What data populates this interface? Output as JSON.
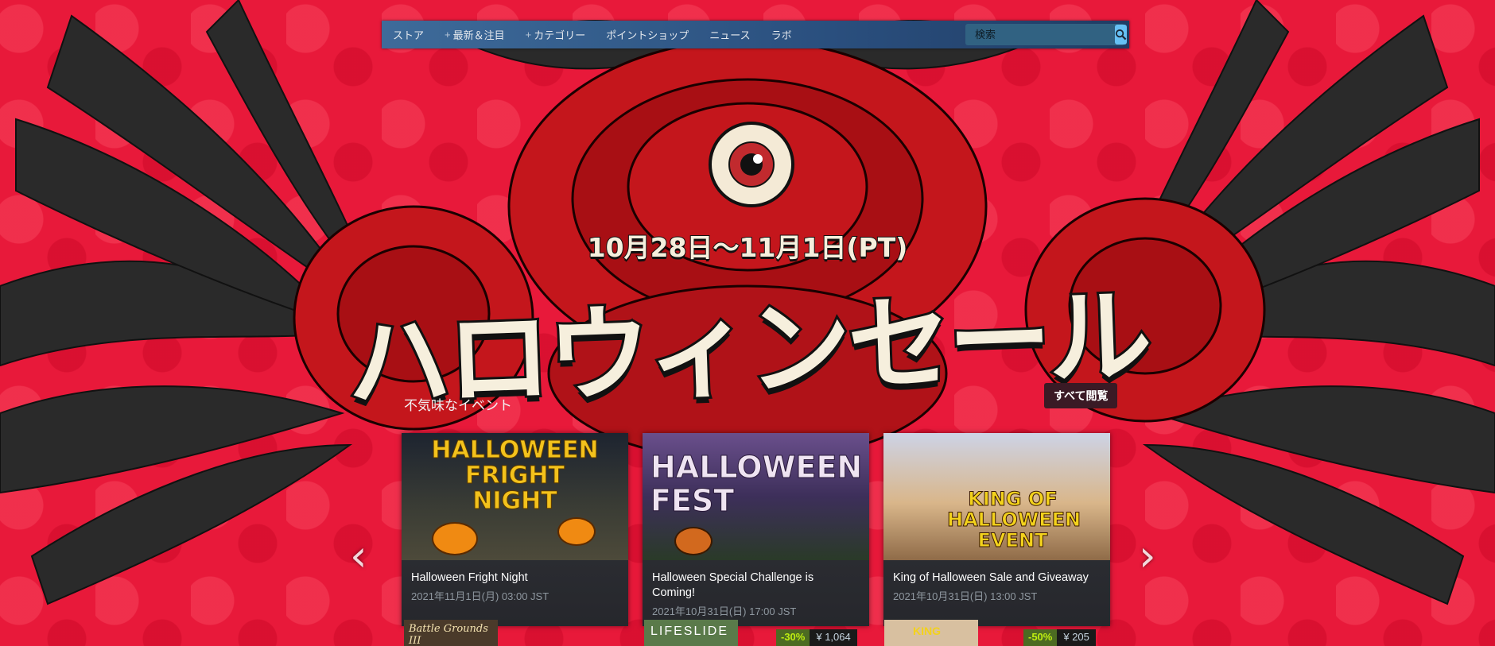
{
  "nav": {
    "items": [
      {
        "label": "ストア",
        "plus": false
      },
      {
        "label": "最新＆注目",
        "plus": true
      },
      {
        "label": "カテゴリー",
        "plus": true
      },
      {
        "label": "ポイントショップ",
        "plus": false
      },
      {
        "label": "ニュース",
        "plus": false
      },
      {
        "label": "ラボ",
        "plus": false
      }
    ],
    "search_placeholder": "検索"
  },
  "hero": {
    "dates": "10月28日〜11月1日(PT)",
    "title": "ハロウィンセール"
  },
  "events": {
    "section_label": "不気味なイベント",
    "see_all_label": "すべて閲覧",
    "cards": [
      {
        "thumb_text": "HALLOWEEN FRIGHT NIGHT",
        "title": "Halloween Fright Night",
        "date": "2021年11月1日(月) 03:00 JST"
      },
      {
        "thumb_text": "HALLOWEEN FEST",
        "title": "Halloween Special Challenge is Coming!",
        "date": "2021年10月31日(日) 17:00 JST"
      },
      {
        "thumb_text": "KING OF HALLOWEEN EVENT",
        "title": "King of Halloween Sale and Giveaway",
        "date": "2021年10月31日(日) 13:00 JST"
      }
    ]
  },
  "bottom_strip": {
    "items": [
      {
        "thumb_text": "Battle Grounds III"
      },
      {
        "thumb_text": "LIFESLIDE",
        "discount": "-30%",
        "price": "¥ 1,064"
      },
      {
        "thumb_text": "KING",
        "discount": "-50%",
        "price": "¥ 205"
      }
    ]
  },
  "icons": {
    "search": "search-icon",
    "prev": "chevron-left-icon",
    "next": "chevron-right-icon"
  },
  "colors": {
    "background": "#e8193a",
    "nav": "#2a4f7e",
    "discount_bg": "#4c6b22",
    "discount_text": "#beee11"
  }
}
